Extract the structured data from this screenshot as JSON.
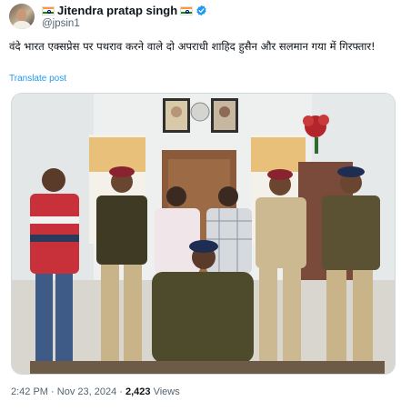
{
  "author": {
    "display_name": "Jitendra pratap singh",
    "handle": "@jpsin1",
    "verified": true,
    "flag_icon": "india-flag-icon"
  },
  "tweet": {
    "text": "वंदे भारत एक्सप्रेस पर पथराव करने वाले दो अपराधी शाहिद हुसैन और सलमान गया में गिरफ्तार!",
    "translate_label": "Translate post"
  },
  "meta": {
    "time": "2:42 PM",
    "separator": "·",
    "date": "Nov 23, 2024",
    "views_count": "2,423",
    "views_label": "Views"
  },
  "colors": {
    "link": "#1d9bf0",
    "verified": "#1d9bf0",
    "secondary_text": "#536471"
  }
}
